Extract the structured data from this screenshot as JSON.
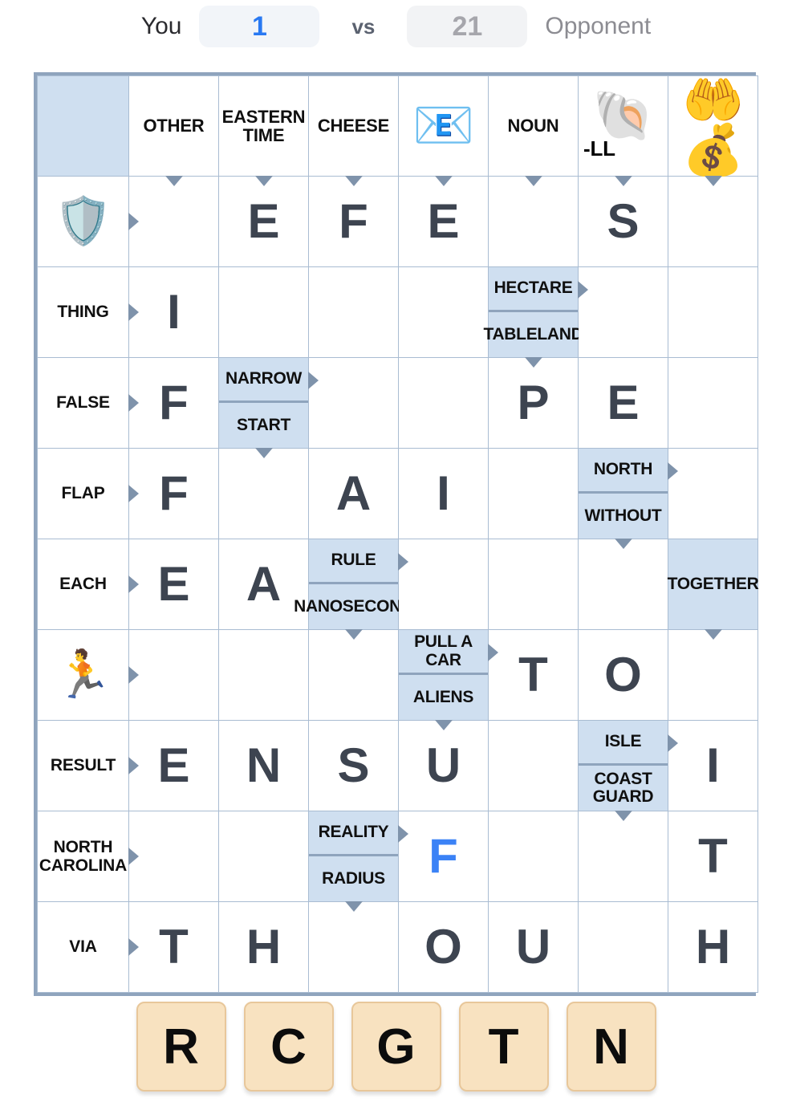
{
  "scorebar": {
    "you_label": "You",
    "you_score": "1",
    "vs": "vs",
    "opponent_score": "21",
    "opponent_label": "Opponent",
    "you_color": "#2979f2",
    "opponent_color": "#a6a6ac"
  },
  "grid": {
    "columns": [
      {
        "type": "corner",
        "label": ""
      },
      {
        "type": "text",
        "label": "OTHER"
      },
      {
        "type": "text",
        "label": "EASTERN TIME"
      },
      {
        "type": "text",
        "label": "CHEESE"
      },
      {
        "type": "emoji",
        "label": "",
        "emoji": "📧",
        "icon_name": "email-icon"
      },
      {
        "type": "text",
        "label": "NOUN"
      },
      {
        "type": "emoji",
        "label": "-LL",
        "emoji": "🐚",
        "icon_name": "shell-icon"
      },
      {
        "type": "emoji",
        "label": "",
        "emoji": "🤲💰",
        "icon_name": "money-in-hand-icon"
      }
    ],
    "rows": [
      {
        "label": "",
        "type": "emoji",
        "emoji": "🛡️",
        "icon_name": "shield-icon"
      },
      {
        "label": "THING",
        "type": "text"
      },
      {
        "label": "FALSE",
        "type": "text"
      },
      {
        "label": "FLAP",
        "type": "text"
      },
      {
        "label": "EACH",
        "type": "text"
      },
      {
        "label": "",
        "type": "emoji",
        "emoji": "🏃",
        "icon_name": "runner-icon"
      },
      {
        "label": "RESULT",
        "type": "text"
      },
      {
        "label": "NORTH CAROLINA",
        "type": "text"
      },
      {
        "label": "VIA",
        "type": "text"
      }
    ],
    "cells": [
      [
        {
          "kind": "empty"
        },
        {
          "kind": "letter",
          "value": "E"
        },
        {
          "kind": "letter",
          "value": "F"
        },
        {
          "kind": "letter",
          "value": "E"
        },
        {
          "kind": "empty"
        },
        {
          "kind": "letter",
          "value": "S"
        },
        {
          "kind": "empty"
        }
      ],
      [
        {
          "kind": "letter",
          "value": "I"
        },
        {
          "kind": "empty"
        },
        {
          "kind": "empty"
        },
        {
          "kind": "empty"
        },
        {
          "kind": "clue",
          "across": "HECTARE",
          "down": "TABLELAND"
        },
        {
          "kind": "empty"
        },
        {
          "kind": "empty"
        }
      ],
      [
        {
          "kind": "letter",
          "value": "F"
        },
        {
          "kind": "clue",
          "across": "NARROW",
          "down": "START"
        },
        {
          "kind": "empty"
        },
        {
          "kind": "empty"
        },
        {
          "kind": "letter",
          "value": "P"
        },
        {
          "kind": "letter",
          "value": "E"
        },
        {
          "kind": "empty"
        }
      ],
      [
        {
          "kind": "letter",
          "value": "F"
        },
        {
          "kind": "empty"
        },
        {
          "kind": "letter",
          "value": "A"
        },
        {
          "kind": "letter",
          "value": "I"
        },
        {
          "kind": "empty"
        },
        {
          "kind": "clue",
          "across": "NORTH",
          "down": "WITHOUT"
        },
        {
          "kind": "empty"
        }
      ],
      [
        {
          "kind": "letter",
          "value": "E"
        },
        {
          "kind": "letter",
          "value": "A"
        },
        {
          "kind": "clue",
          "across": "RULE",
          "down": "NANOSECOND"
        },
        {
          "kind": "empty"
        },
        {
          "kind": "empty"
        },
        {
          "kind": "empty"
        },
        {
          "kind": "clue",
          "down": "TOGETHER"
        }
      ],
      [
        {
          "kind": "empty"
        },
        {
          "kind": "empty"
        },
        {
          "kind": "empty"
        },
        {
          "kind": "clue",
          "across": "PULL A CAR",
          "down": "ALIENS"
        },
        {
          "kind": "letter",
          "value": "T"
        },
        {
          "kind": "letter",
          "value": "O"
        },
        {
          "kind": "empty"
        }
      ],
      [
        {
          "kind": "letter",
          "value": "E"
        },
        {
          "kind": "letter",
          "value": "N"
        },
        {
          "kind": "letter",
          "value": "S"
        },
        {
          "kind": "letter",
          "value": "U"
        },
        {
          "kind": "empty"
        },
        {
          "kind": "clue",
          "across": "ISLE",
          "down": "COAST GUARD"
        },
        {
          "kind": "letter",
          "value": "I"
        }
      ],
      [
        {
          "kind": "empty"
        },
        {
          "kind": "empty"
        },
        {
          "kind": "clue",
          "across": "REALITY",
          "down": "RADIUS"
        },
        {
          "kind": "letter",
          "value": "F",
          "fresh": true
        },
        {
          "kind": "empty"
        },
        {
          "kind": "empty"
        },
        {
          "kind": "letter",
          "value": "T"
        }
      ],
      [
        {
          "kind": "letter",
          "value": "T"
        },
        {
          "kind": "letter",
          "value": "H"
        },
        {
          "kind": "empty"
        },
        {
          "kind": "letter",
          "value": "O"
        },
        {
          "kind": "letter",
          "value": "U"
        },
        {
          "kind": "empty"
        },
        {
          "kind": "letter",
          "value": "H"
        }
      ]
    ]
  },
  "rack": {
    "tiles": [
      "R",
      "C",
      "G",
      "T",
      "N"
    ]
  },
  "colors": {
    "clue_bg": "#cfdff0",
    "letter_bg": "#eef1f6",
    "empty_bg": "#ffffff",
    "grid_border": "#8fa4bd",
    "letter_text": "#3d4450",
    "fresh_letter": "#3b82f6",
    "tile_bg": "#f8e2c0"
  }
}
